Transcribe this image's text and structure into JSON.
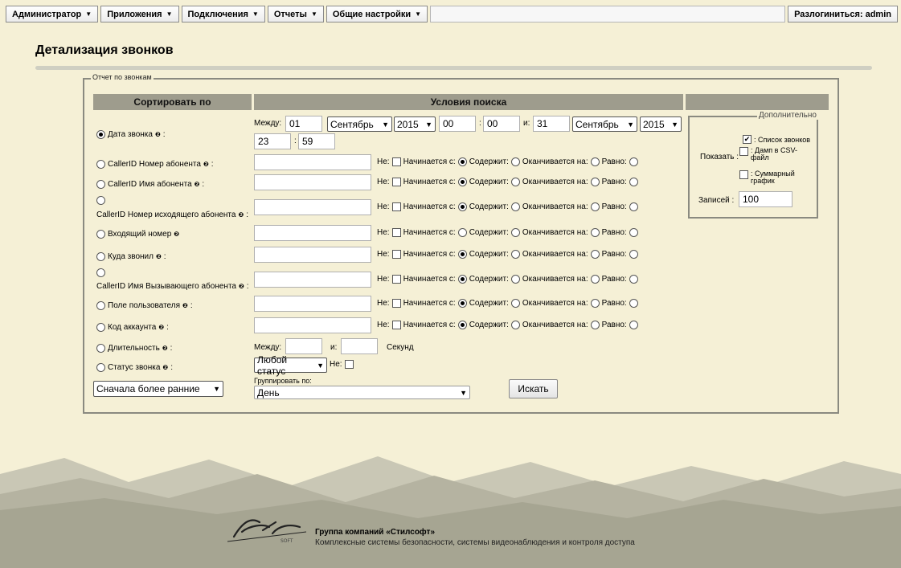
{
  "menu": {
    "admin": "Администратор",
    "apps": "Приложения",
    "connections": "Подключения",
    "reports": "Отчеты",
    "settings": "Общие настройки",
    "logout": "Разлогиниться: admin"
  },
  "page": {
    "title": "Детализация звонков",
    "report_legend": "Отчет по звонкам"
  },
  "headers": {
    "sort": "Сортировать по",
    "search": "Условия поиска"
  },
  "date_row": {
    "label": "Дата звонка",
    "between": "Между:",
    "day_from": "01",
    "month_from": "Сентябрь",
    "year_from": "2015",
    "hour_from": "00",
    "min_from": "00",
    "and": "и:",
    "day_to": "31",
    "month_to": "Сентябрь",
    "year_to": "2015",
    "hour_to": "23",
    "min_to": "59"
  },
  "fields": [
    {
      "label": "CallerID Номер абонента",
      "contains": true
    },
    {
      "label": "CallerID Имя абонента",
      "contains": true
    },
    {
      "label": "CallerID Номер исходящего абонента",
      "contains": true
    },
    {
      "label": "Входящий номер",
      "contains": false
    },
    {
      "label": "Куда звонил",
      "contains": true
    },
    {
      "label": "CallerID Имя Вызывающего абонента",
      "contains": true
    },
    {
      "label": "Поле пользователя",
      "contains": true
    },
    {
      "label": "Код аккаунта",
      "contains": true
    }
  ],
  "cond": {
    "not": "Не:",
    "starts": "Начинается с:",
    "contains": "Содержит:",
    "ends": "Оканчивается на:",
    "equals": "Равно:"
  },
  "duration": {
    "label": "Длительность",
    "between": "Между:",
    "and": "и:",
    "unit": "Секунд"
  },
  "status": {
    "label": "Статус звонка",
    "value": "Любой статус",
    "not": "Не:"
  },
  "order": {
    "value": "Сначала более ранние"
  },
  "group": {
    "label": "Группировать по:",
    "value": "День"
  },
  "search_button": "Искать",
  "extra": {
    "legend": "Дополнительно",
    "show": "Показать :",
    "opt_list": ": Список звонков",
    "opt_csv": ": Дамп в CSV-файл",
    "opt_graph": ": Суммарный график",
    "records_label": "Записей :",
    "records_value": "100"
  },
  "footer": {
    "company": "Группа компаний «Стилсофт»",
    "description": "Комплексные системы безопасности, системы видеонаблюдения и контроля доступа"
  },
  "colors": {
    "background": "#f5f0d6",
    "header": "#9e9c8d",
    "border": "#8a8a80"
  }
}
